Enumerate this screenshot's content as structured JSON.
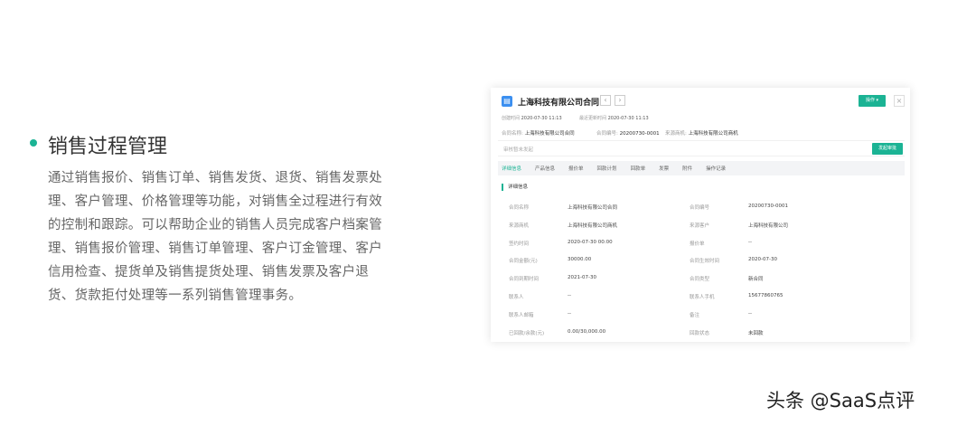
{
  "intro": {
    "heading": "销售过程管理",
    "paragraph": "通过销售报价、销售订单、销售发货、退货、销售发票处理、客户管理、价格管理等功能，对销售全过程进行有效的控制和跟踪。可以帮助企业的销售人员完成客户档案管理、销售报价管理、销售订单管理、客户订金管理、客户信用检查、提货单及销售提货处理、销售发票及客户退货、货款拒付处理等一系列销售管理事务。"
  },
  "card": {
    "title": "上海科技有限公司合同",
    "action_button": "操作 ▾",
    "created_label": "创建时间",
    "created_value": "2020-07-30 11:13",
    "updated_label": "最近更新时间",
    "updated_value": "2020-07-30 11:13",
    "name_label": "合同名称:",
    "name_value": "上海科技有限公司合同",
    "no_label": "合同编号:",
    "no_value": "20200730-0001",
    "source_label": "来源商机:",
    "source_value": "上海科技有限公司商机",
    "review_status": "审核暂未发起",
    "start_review_button": "发起审批",
    "tabs": [
      "详细信息",
      "产品信息",
      "报价单",
      "回款计划",
      "回款单",
      "发票",
      "附件",
      "操作记录"
    ],
    "section_title": "详细信息",
    "fields": [
      [
        "合同名称",
        "上海科技有限公司合同",
        "合同编号",
        "20200730-0001"
      ],
      [
        "来源商机",
        "上海科技有限公司商机",
        "来源客户",
        "上海科技有限公司"
      ],
      [
        "签约时间",
        "2020-07-30 00:00",
        "报价单",
        "--"
      ],
      [
        "合同金额(元)",
        "30000.00",
        "合同生效时间",
        "2020-07-30"
      ],
      [
        "合同到期时间",
        "2021-07-30",
        "合同类型",
        "新合同"
      ],
      [
        "联系人",
        "--",
        "联系人手机",
        "15677860765"
      ],
      [
        "联系人邮箱",
        "--",
        "备注",
        "--"
      ],
      [
        "已回款/余款(元)",
        "0.00/30,000.00",
        "回款状态",
        "未回款"
      ]
    ]
  },
  "watermark": "头条 @SaaS点评"
}
